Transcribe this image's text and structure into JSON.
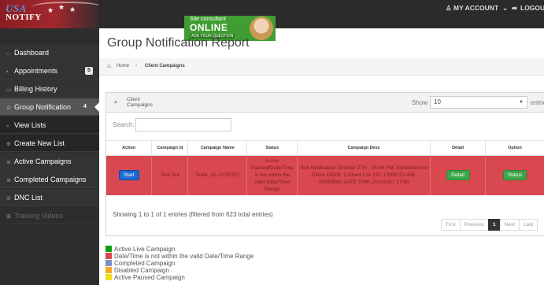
{
  "header": {
    "logo_line1": "USA",
    "logo_line2": "NOTIFY",
    "ad": {
      "line1": "Site consultant",
      "line2": "ONLINE",
      "line3": "ASK YOUR QUESTION"
    },
    "my_account": "MY ACCOUNT",
    "logout": "LOGOUT"
  },
  "sidebar": {
    "items": [
      {
        "label": "Dashboard",
        "icon": "home-icon"
      },
      {
        "label": "Appointments",
        "icon": "calendar-icon",
        "badge": "5"
      },
      {
        "label": "Billing History",
        "icon": "card-icon"
      },
      {
        "label": "Group Notification",
        "icon": "gear-icon",
        "badge": "4"
      },
      {
        "label": "View Lists",
        "icon": "search-icon"
      },
      {
        "label": "Create New List",
        "icon": "plus-circle-icon"
      },
      {
        "label": "Active Campaigns",
        "icon": "list-icon"
      },
      {
        "label": "Completed Campaigns",
        "icon": "list-icon"
      },
      {
        "label": "DNC List",
        "icon": "ban-icon"
      },
      {
        "label": "Training Videos",
        "icon": "grid-icon"
      }
    ]
  },
  "main": {
    "title": "Group Notification Report",
    "breadcrumb": {
      "home": "Home",
      "current": "Client Campaigns"
    },
    "panel_title": "Client Campaigns",
    "show_label": "Show",
    "show_value": "10",
    "entries_label": "entries",
    "search_label": "Search:",
    "search_value": "",
    "table": {
      "headers": [
        "Action",
        "Campaign Id",
        "Campaign Name",
        "Status",
        "Campaign Desc",
        "Detail",
        "Option"
      ],
      "rows": [
        {
          "action": "Start",
          "campaign_id": "Test.Not",
          "campaign_name": "Test4_10-27(TEST)",
          "status": "Active Paused/Date/Time is not within the valid Date/Time Range",
          "desc": "Test Notification October 27th - 05:56 PM. Scheduled for Client-18208. Contact List-191. USER ID-406. SENDING DATE TIME-20141027 17:59",
          "detail": "Detail",
          "option": "Status"
        }
      ]
    },
    "info": "Showing 1 to 1 of 1 entries (filtered from 623 total entries)",
    "pager": [
      "First",
      "Previous",
      "1",
      "Next",
      "Last"
    ]
  },
  "legend": [
    {
      "label": "Active Live Campaign",
      "color": "#129e12"
    },
    {
      "label": "Date/Time is not within the valid Date/Time Range",
      "color": "#d9484f"
    },
    {
      "label": "Completed Campaign",
      "color": "#7d8fc7"
    },
    {
      "label": "Disabled Campaign",
      "color": "#f5a623"
    },
    {
      "label": "Active Paused Campaign",
      "color": "#f2dc1c"
    }
  ]
}
